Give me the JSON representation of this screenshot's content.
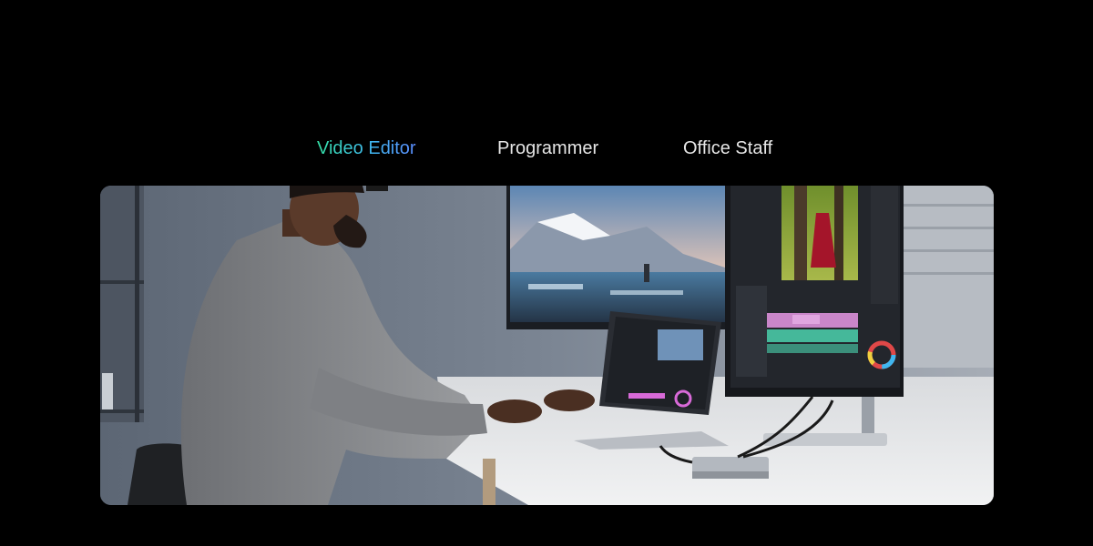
{
  "tabs": [
    {
      "label": "Video Editor",
      "active": true
    },
    {
      "label": "Programmer",
      "active": false
    },
    {
      "label": "Office Staff",
      "active": false
    }
  ],
  "colors": {
    "background": "#000000",
    "tab_text": "#e6e6e6",
    "active_gradient_start": "#35e0a6",
    "active_gradient_end": "#5b8cff"
  }
}
